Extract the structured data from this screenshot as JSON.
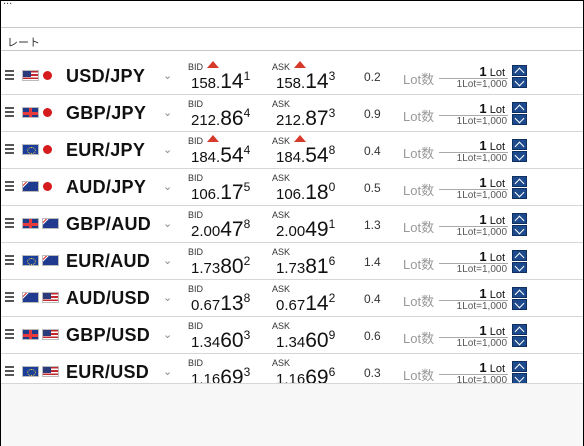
{
  "header": {
    "top_sliver": "...",
    "section_title": "レート"
  },
  "columns": {
    "bid_label": "BID",
    "ask_label": "ASK",
    "lot_label": "Lot数",
    "lot_unit": "Lot",
    "lot_note": "1Lot=1,000"
  },
  "colors": {
    "up_arrow": "#d63a2a",
    "stepper_blue": "#1d4a8c"
  },
  "rows": [
    {
      "pair": "USD/JPY",
      "flags": [
        "us-flag-icon",
        "jp-flag-icon"
      ],
      "bid_up": true,
      "ask_up": true,
      "bid": {
        "a": "158.",
        "b": "14",
        "c": "1"
      },
      "ask": {
        "a": "158.",
        "b": "14",
        "c": "3"
      },
      "spread": "0.2",
      "lot": "1"
    },
    {
      "pair": "GBP/JPY",
      "flags": [
        "gb-flag-icon",
        "jp-flag-icon"
      ],
      "bid_up": false,
      "ask_up": false,
      "bid": {
        "a": "212.",
        "b": "86",
        "c": "4"
      },
      "ask": {
        "a": "212.",
        "b": "87",
        "c": "3"
      },
      "spread": "0.9",
      "lot": "1"
    },
    {
      "pair": "EUR/JPY",
      "flags": [
        "eu-flag-icon",
        "jp-flag-icon"
      ],
      "bid_up": true,
      "ask_up": true,
      "bid": {
        "a": "184.",
        "b": "54",
        "c": "4"
      },
      "ask": {
        "a": "184.",
        "b": "54",
        "c": "8"
      },
      "spread": "0.4",
      "lot": "1"
    },
    {
      "pair": "AUD/JPY",
      "flags": [
        "au-flag-icon",
        "jp-flag-icon"
      ],
      "bid_up": false,
      "ask_up": false,
      "bid": {
        "a": "106.",
        "b": "17",
        "c": "5"
      },
      "ask": {
        "a": "106.",
        "b": "18",
        "c": "0"
      },
      "spread": "0.5",
      "lot": "1"
    },
    {
      "pair": "GBP/AUD",
      "flags": [
        "gb-flag-icon",
        "au-flag-icon"
      ],
      "bid_up": false,
      "ask_up": false,
      "bid": {
        "a": "2.00",
        "b": "47",
        "c": "8"
      },
      "ask": {
        "a": "2.00",
        "b": "49",
        "c": "1"
      },
      "spread": "1.3",
      "lot": "1"
    },
    {
      "pair": "EUR/AUD",
      "flags": [
        "eu-flag-icon",
        "au-flag-icon"
      ],
      "bid_up": false,
      "ask_up": false,
      "bid": {
        "a": "1.73",
        "b": "80",
        "c": "2"
      },
      "ask": {
        "a": "1.73",
        "b": "81",
        "c": "6"
      },
      "spread": "1.4",
      "lot": "1"
    },
    {
      "pair": "AUD/USD",
      "flags": [
        "au-flag-icon",
        "us-flag-icon"
      ],
      "bid_up": false,
      "ask_up": false,
      "bid": {
        "a": "0.67",
        "b": "13",
        "c": "8"
      },
      "ask": {
        "a": "0.67",
        "b": "14",
        "c": "2"
      },
      "spread": "0.4",
      "lot": "1"
    },
    {
      "pair": "GBP/USD",
      "flags": [
        "gb-flag-icon",
        "us-flag-icon"
      ],
      "bid_up": false,
      "ask_up": false,
      "bid": {
        "a": "1.34",
        "b": "60",
        "c": "3"
      },
      "ask": {
        "a": "1.34",
        "b": "60",
        "c": "9"
      },
      "spread": "0.6",
      "lot": "1"
    },
    {
      "pair": "EUR/USD",
      "flags": [
        "eu-flag-icon",
        "us-flag-icon"
      ],
      "bid_up": false,
      "ask_up": false,
      "bid": {
        "a": "1.16",
        "b": "69",
        "c": "3"
      },
      "ask": {
        "a": "1.16",
        "b": "69",
        "c": "6"
      },
      "spread": "0.3",
      "lot": "1"
    }
  ]
}
